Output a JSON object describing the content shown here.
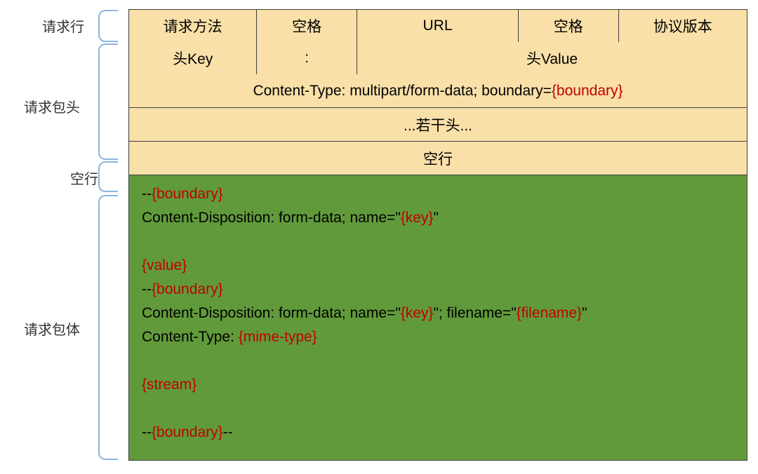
{
  "sideLabels": {
    "requestLine": "请求行",
    "requestHeader": "请求包头",
    "blankLine": "空行",
    "requestBody": "请求包体"
  },
  "row1": {
    "method": "请求方法",
    "space1": "空格",
    "url": "URL",
    "space2": "空格",
    "version": "协议版本"
  },
  "row2": {
    "hkey": "头Key",
    "colon": ":",
    "hvalue": "头Value"
  },
  "row3": {
    "prefix": "Content-Type: multipart/form-data; boundary=",
    "boundary": "{boundary}"
  },
  "row4": {
    "text": "...若干头..."
  },
  "row5": {
    "text": "空行"
  },
  "body": {
    "l1a": "--",
    "l1b": "{boundary}",
    "l2a": "Content-Disposition: form-data; name=\"",
    "l2b": "{key}",
    "l2c": "\"",
    "blank1": " ",
    "l4": "{value}",
    "l5a": "--",
    "l5b": "{boundary}",
    "l6a": "Content-Disposition: form-data; name=\"",
    "l6b": "{key}",
    "l6c": "\"; filename=\"",
    "l6d": "{filename}",
    "l6e": "\"",
    "l7a": "Content-Type: ",
    "l7b": "{mime-type}",
    "blank2": " ",
    "l9": "{stream}",
    "blank3": " ",
    "l11a": "--",
    "l11b": "{boundary}",
    "l11c": "--"
  }
}
